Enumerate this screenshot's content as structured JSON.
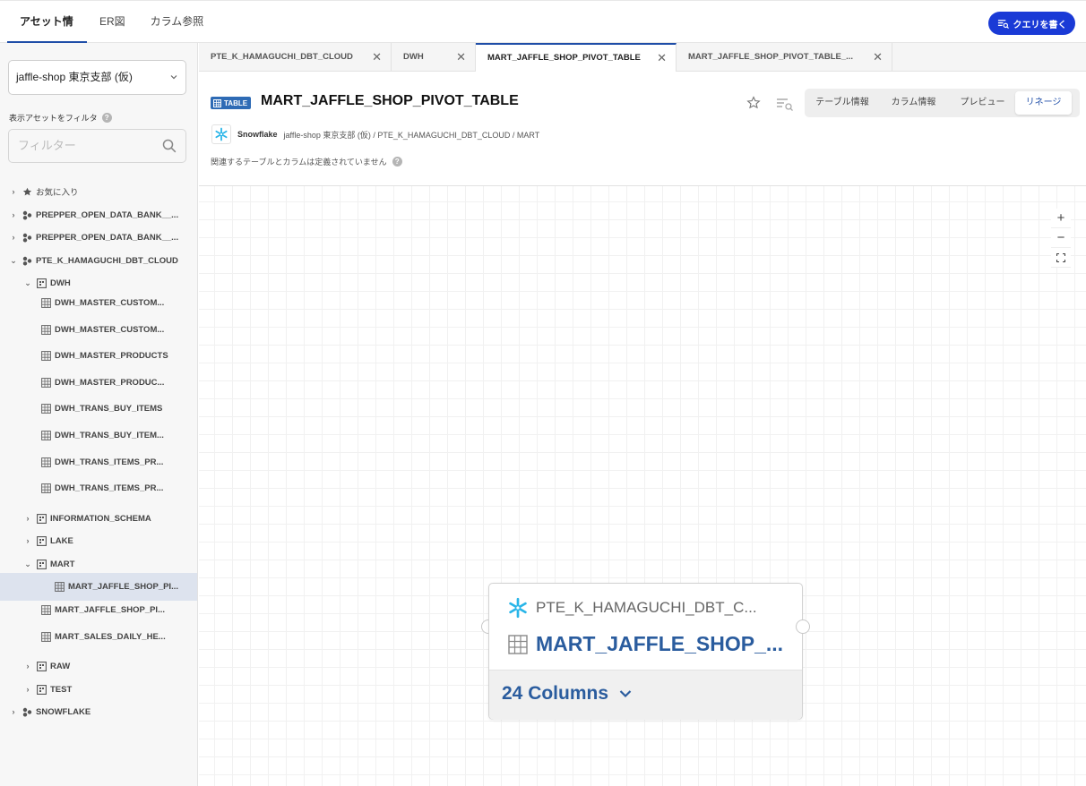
{
  "topnav": {
    "tabs": [
      "アセット情報",
      "ER図",
      "カラム参照"
    ],
    "query_button": "クエリを書く"
  },
  "sidebar": {
    "org_select": "jaffle-shop 東京支部 (仮)",
    "filter_label": "表示アセットをフィルタ",
    "filter_placeholder": "フィルター",
    "tree": [
      {
        "label": "お気に入り",
        "icon": "star-icon"
      },
      {
        "label": "PREPPER_OPEN_DATA_BANK__...",
        "icon": "database-icon"
      },
      {
        "label": "PREPPER_OPEN_DATA_BANK__...",
        "icon": "database-icon"
      },
      {
        "label": "PTE_K_HAMAGUCHI_DBT_CLOUD",
        "icon": "database-icon"
      },
      {
        "label": "DWH",
        "icon": "schema-icon"
      },
      {
        "label": "DWH_MASTER_CUSTOM...",
        "icon": "table-icon"
      },
      {
        "label": "DWH_MASTER_CUSTOM...",
        "icon": "table-icon"
      },
      {
        "label": "DWH_MASTER_PRODUCTS",
        "icon": "table-icon"
      },
      {
        "label": "DWH_MASTER_PRODUC...",
        "icon": "table-icon"
      },
      {
        "label": "DWH_TRANS_BUY_ITEMS",
        "icon": "table-icon"
      },
      {
        "label": "DWH_TRANS_BUY_ITEM...",
        "icon": "table-icon"
      },
      {
        "label": "DWH_TRANS_ITEMS_PR...",
        "icon": "table-icon"
      },
      {
        "label": "DWH_TRANS_ITEMS_PR...",
        "icon": "table-icon"
      },
      {
        "label": "INFORMATION_SCHEMA",
        "icon": "schema-icon"
      },
      {
        "label": "LAKE",
        "icon": "schema-icon"
      },
      {
        "label": "MART",
        "icon": "schema-icon"
      },
      {
        "label": "MART_JAFFLE_SHOP_PI...",
        "icon": "table-icon"
      },
      {
        "label": "MART_JAFFLE_SHOP_PI...",
        "icon": "table-icon"
      },
      {
        "label": "MART_SALES_DAILY_HE...",
        "icon": "table-icon"
      },
      {
        "label": "RAW",
        "icon": "schema-icon"
      },
      {
        "label": "TEST",
        "icon": "schema-icon"
      },
      {
        "label": "SNOWFLAKE",
        "icon": "database-icon"
      }
    ]
  },
  "filetabs": [
    {
      "label": "PTE_K_HAMAGUCHI_DBT_CLOUD",
      "close": "✕"
    },
    {
      "label": "DWH",
      "close": "✕"
    },
    {
      "label": "MART_JAFFLE_SHOP_PIVOT_TABLE",
      "close": "✕"
    },
    {
      "label": "MART_JAFFLE_SHOP_PIVOT_TABLE_...",
      "close": "✕"
    }
  ],
  "asset": {
    "badge": "TABLE",
    "title": "MART_JAFFLE_SHOP_PIVOT_TABLE",
    "source_name": "Snowflake",
    "path": "jaffle-shop 東京支部 (仮) / PTE_K_HAMAGUCHI_DBT_CLOUD / MART",
    "note": "関連するテーブルとカラムは定義されていません",
    "views": [
      "テーブル情報",
      "カラム情報",
      "プレビュー",
      "リネージ"
    ]
  },
  "zoom": {
    "in": "+",
    "out": "−"
  },
  "node": {
    "source": "PTE_K_HAMAGUCHI_DBT_C...",
    "name": "MART_JAFFLE_SHOP_...",
    "columns": "24 Columns"
  },
  "colors": {
    "accent": "#1a3ad6",
    "nav_underline": "#1f4ea8",
    "node_text": "#2a5c9e",
    "badge": "#2e6bb5",
    "snowflake": "#29b5e8"
  }
}
